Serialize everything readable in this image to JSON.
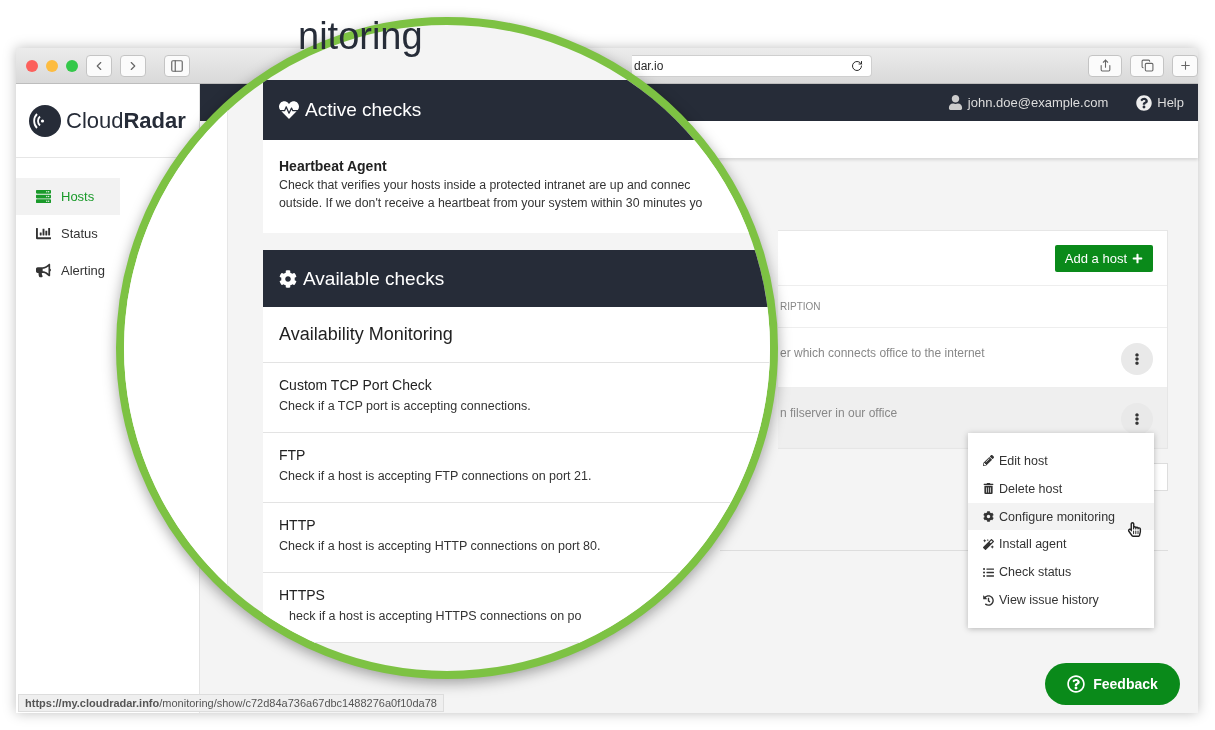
{
  "browser": {
    "address": "dar.io"
  },
  "sidebar": {
    "logo": "Cloud**Radar**",
    "items": [
      {
        "label": "Hosts",
        "kind": "hosts",
        "selected": true
      },
      {
        "label": "Status",
        "kind": "status",
        "selected": false
      },
      {
        "label": "Alerting",
        "kind": "alerting",
        "selected": false
      }
    ]
  },
  "header": {
    "user": "john.doe@example.com",
    "help": "Help"
  },
  "hosts_card": {
    "add_button": "Add a host",
    "column_header": "RIPTION",
    "rows": [
      {
        "description": "er which connects office to the internet",
        "highlighted": false
      },
      {
        "description": "n filserver in our office",
        "highlighted": true
      }
    ]
  },
  "context_menu": {
    "items": [
      {
        "label": "Edit host",
        "kind": "edit",
        "selected": false
      },
      {
        "label": "Delete host",
        "kind": "delete",
        "selected": false
      },
      {
        "label": "Configure monitoring",
        "kind": "configure",
        "selected": true
      },
      {
        "label": "Install agent",
        "kind": "install",
        "selected": false
      },
      {
        "label": "Check status",
        "kind": "status",
        "selected": false
      },
      {
        "label": "View issue history",
        "kind": "history",
        "selected": false
      }
    ]
  },
  "feedback_button": "Feedback",
  "status_url": "**https://my.cloudradar.info**/monitoring/show/c72d84a736a67dbc1488276a0f10da78",
  "magnifier": {
    "heading": "nitoring",
    "active_checks": {
      "title": "Active checks",
      "items": [
        {
          "name": "Heartbeat Agent",
          "lines": [
            "Check that verifies your hosts inside a protected intranet are up and connec",
            "outside. If we don't receive a heartbeat from your system within 30 minutes yo"
          ]
        }
      ]
    },
    "available_checks": {
      "title": "Available checks",
      "group": "Availability Monitoring",
      "items": [
        {
          "name": "Custom TCP Port Check",
          "description": "Check if a TCP port is accepting connections."
        },
        {
          "name": "FTP",
          "description": "Check if a host is accepting FTP connections on port 21."
        },
        {
          "name": "HTTP",
          "description": "Check if a host is accepting HTTP connections on port 80."
        },
        {
          "name": "HTTPS",
          "description": "heck if a host is accepting HTTPS connections on po"
        }
      ]
    }
  }
}
